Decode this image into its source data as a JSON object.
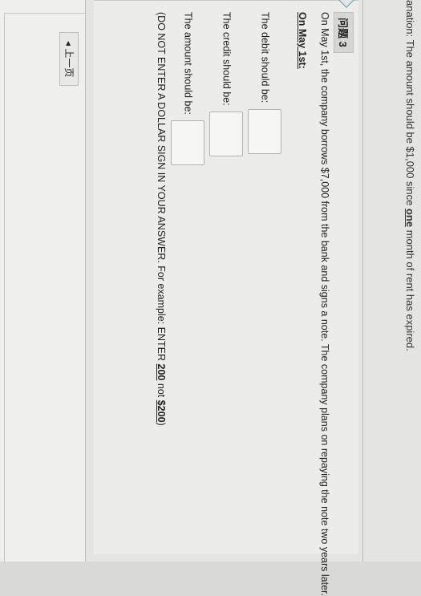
{
  "explanation": {
    "prefix": "anation: The amount should be $1,000 since ",
    "emph": "one",
    "suffix": " month of rent has expired."
  },
  "question": {
    "title": "问题 3",
    "paragraph": "On May 1st, the company borrows $7,000 from the bank and signs a note. The company plans on repaying the note two years later.",
    "date_heading": "On May 1st:",
    "debit_label": "The debit should be:",
    "credit_label": "The credit should be:",
    "amount_label": "The amount should be:",
    "note_prefix": "(DO NOT ENTER A DOLLAR SIGN IN YOUR ANSWER. For example: ENTER ",
    "note_ex1": "200",
    "note_mid": " not ",
    "note_ex2": "$200",
    "note_suffix": ")",
    "debit_value": "",
    "credit_value": "",
    "amount_value": ""
  },
  "nav": {
    "prev_label": "◂ 上一页"
  }
}
